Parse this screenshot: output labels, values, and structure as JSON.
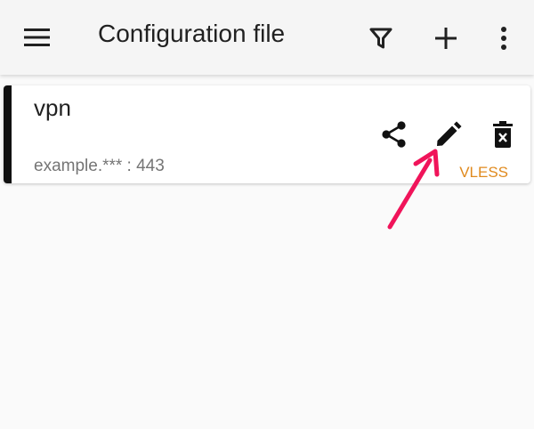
{
  "appbar": {
    "title": "Configuration file",
    "icons": {
      "menu": "menu-icon",
      "filter": "filter-icon",
      "add": "add-icon",
      "more": "more-vert-icon"
    }
  },
  "servers": [
    {
      "remarks": "vpn",
      "address": "example.*** : 443",
      "type": "VLESS",
      "accent_color": "#111111",
      "type_color": "#e08a1e",
      "actions": {
        "share": "share-icon",
        "edit": "edit-icon",
        "delete": "delete-icon"
      }
    }
  ],
  "annotation": {
    "arrow_color": "#f0145a",
    "points_to": "edit-icon"
  }
}
